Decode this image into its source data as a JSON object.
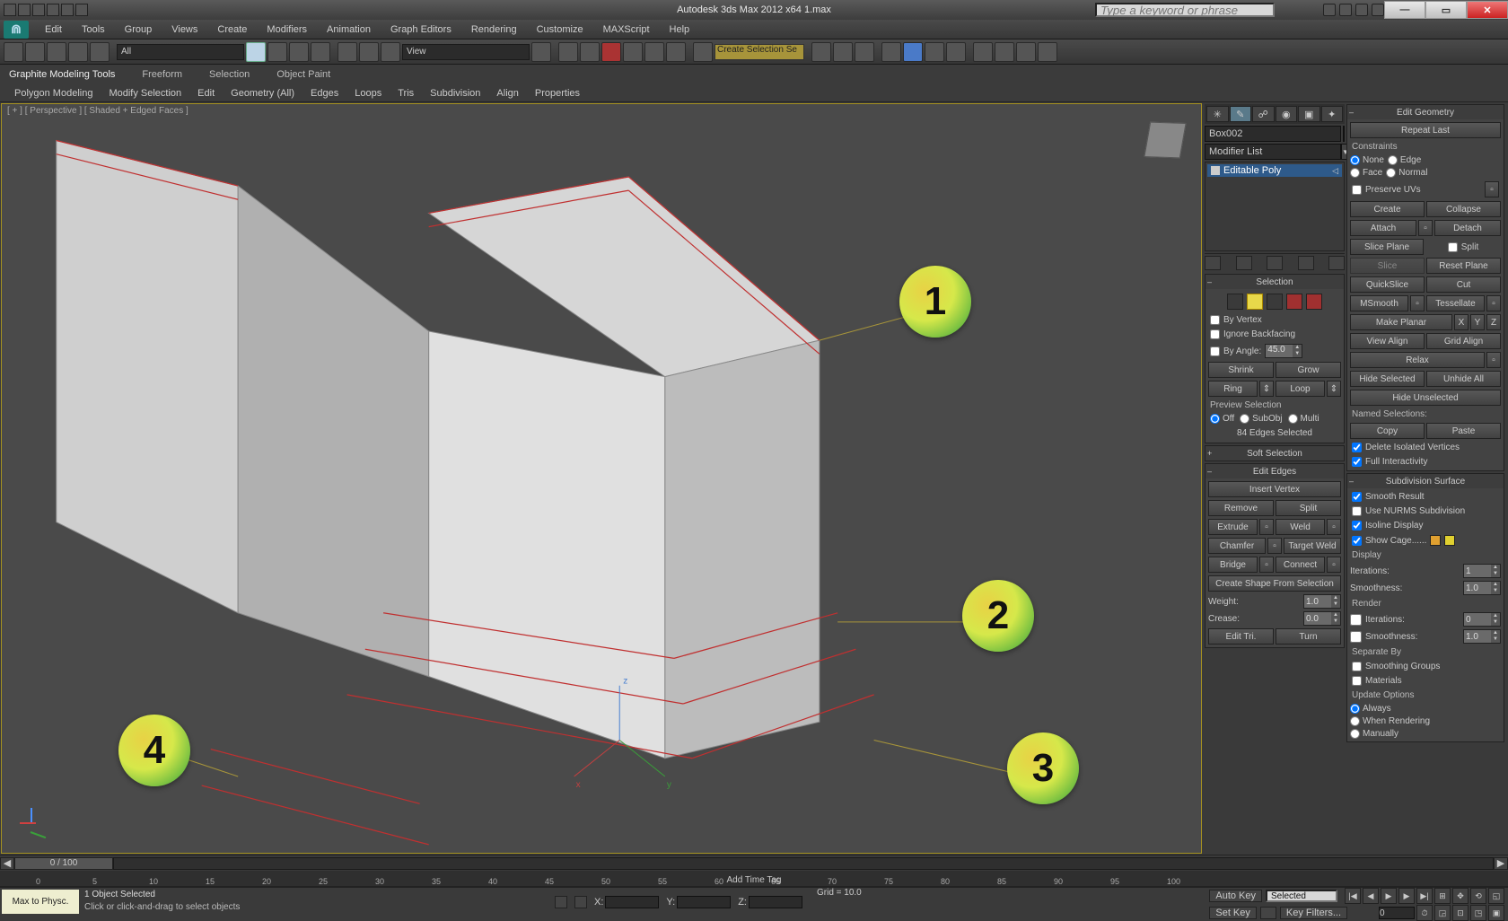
{
  "titlebar": {
    "app_title": "Autodesk 3ds Max 2012 x64   1.max",
    "search_placeholder": "Type a keyword or phrase"
  },
  "menubar": {
    "items": [
      "Edit",
      "Tools",
      "Group",
      "Views",
      "Create",
      "Modifiers",
      "Animation",
      "Graph Editors",
      "Rendering",
      "Customize",
      "MAXScript",
      "Help"
    ]
  },
  "maintoolbar": {
    "all_dropdown": "All",
    "view_dropdown": "View",
    "create_sel": "Create Selection Se"
  },
  "ribbon": {
    "tabs": [
      "Graphite Modeling Tools",
      "Freeform",
      "Selection",
      "Object Paint"
    ],
    "sub": [
      "Polygon Modeling",
      "Modify Selection",
      "Edit",
      "Geometry (All)",
      "Edges",
      "Loops",
      "Tris",
      "Subdivision",
      "Align",
      "Properties"
    ]
  },
  "viewport": {
    "label": "[ + ] [ Perspective ] [ Shaded + Edged Faces ]",
    "annotations": [
      "1",
      "2",
      "3",
      "4"
    ],
    "axes": {
      "x": "x",
      "y": "y",
      "z": "z"
    }
  },
  "time": {
    "slider_label": "0 / 100",
    "ticks": [
      0,
      5,
      10,
      15,
      20,
      25,
      30,
      35,
      40,
      45,
      50,
      55,
      60,
      65,
      70,
      75,
      80,
      85,
      90,
      95,
      100
    ]
  },
  "status": {
    "maxscript": "Max to Physc.",
    "selected": "1 Object Selected",
    "prompt": "Click or click-and-drag to select objects",
    "x": "X:",
    "y": "Y:",
    "z": "Z:",
    "grid": "Grid = 10.0",
    "add_time_tag": "Add Time Tag",
    "auto_key": "Auto Key",
    "set_key": "Set Key",
    "selected_mode": "Selected",
    "key_filters": "Key Filters..."
  },
  "panel": {
    "object_name": "Box002",
    "modifier_list": "Modifier List",
    "mod_item": "Editable Poly",
    "selection": {
      "head": "Selection",
      "by_vertex": "By Vertex",
      "ignore_backfacing": "Ignore Backfacing",
      "by_angle": "By Angle:",
      "angle_val": "45.0",
      "shrink": "Shrink",
      "grow": "Grow",
      "ring": "Ring",
      "loop": "Loop",
      "preview": "Preview Selection",
      "off": "Off",
      "subobj": "SubObj",
      "multi": "Multi",
      "status": "84 Edges Selected"
    },
    "soft_sel_head": "Soft Selection",
    "edit_edges": {
      "head": "Edit Edges",
      "insert_vertex": "Insert Vertex",
      "remove": "Remove",
      "split": "Split",
      "extrude": "Extrude",
      "weld": "Weld",
      "chamfer": "Chamfer",
      "target_weld": "Target Weld",
      "bridge": "Bridge",
      "connect": "Connect",
      "create_shape": "Create Shape From Selection",
      "weight": "Weight:",
      "weight_val": "1.0",
      "crease": "Crease:",
      "crease_val": "0.0",
      "edit_tri": "Edit Tri.",
      "turn": "Turn"
    }
  },
  "edit_geom": {
    "head": "Edit Geometry",
    "repeat_last": "Repeat Last",
    "constraints": "Constraints",
    "none": "None",
    "edge": "Edge",
    "face": "Face",
    "normal": "Normal",
    "preserve_uvs": "Preserve UVs",
    "create": "Create",
    "collapse": "Collapse",
    "attach": "Attach",
    "detach": "Detach",
    "slice_plane": "Slice Plane",
    "split": "Split",
    "slice": "Slice",
    "reset_plane": "Reset Plane",
    "quickslice": "QuickSlice",
    "cut": "Cut",
    "msmooth": "MSmooth",
    "tessellate": "Tessellate",
    "make_planar": "Make Planar",
    "x": "X",
    "y": "Y",
    "z": "Z",
    "view_align": "View Align",
    "grid_align": "Grid Align",
    "relax": "Relax",
    "hide_selected": "Hide Selected",
    "unhide_all": "Unhide All",
    "hide_unselected": "Hide Unselected",
    "named_sel": "Named Selections:",
    "copy": "Copy",
    "paste": "Paste",
    "del_iso": "Delete Isolated Vertices",
    "full_int": "Full Interactivity"
  },
  "subd": {
    "head": "Subdivision Surface",
    "smooth_result": "Smooth Result",
    "use_nurms": "Use NURMS Subdivision",
    "isoline": "Isoline Display",
    "show_cage": "Show Cage......",
    "display": "Display",
    "iterations": "Iterations:",
    "it_val": "1",
    "smoothness": "Smoothness:",
    "sm_val": "1.0",
    "render": "Render",
    "r_it_val": "0",
    "r_sm_val": "1.0",
    "separate_by": "Separate By",
    "smoothing_groups": "Smoothing Groups",
    "materials": "Materials",
    "update_options": "Update Options",
    "always": "Always",
    "when_rendering": "When Rendering",
    "manually": "Manually"
  }
}
